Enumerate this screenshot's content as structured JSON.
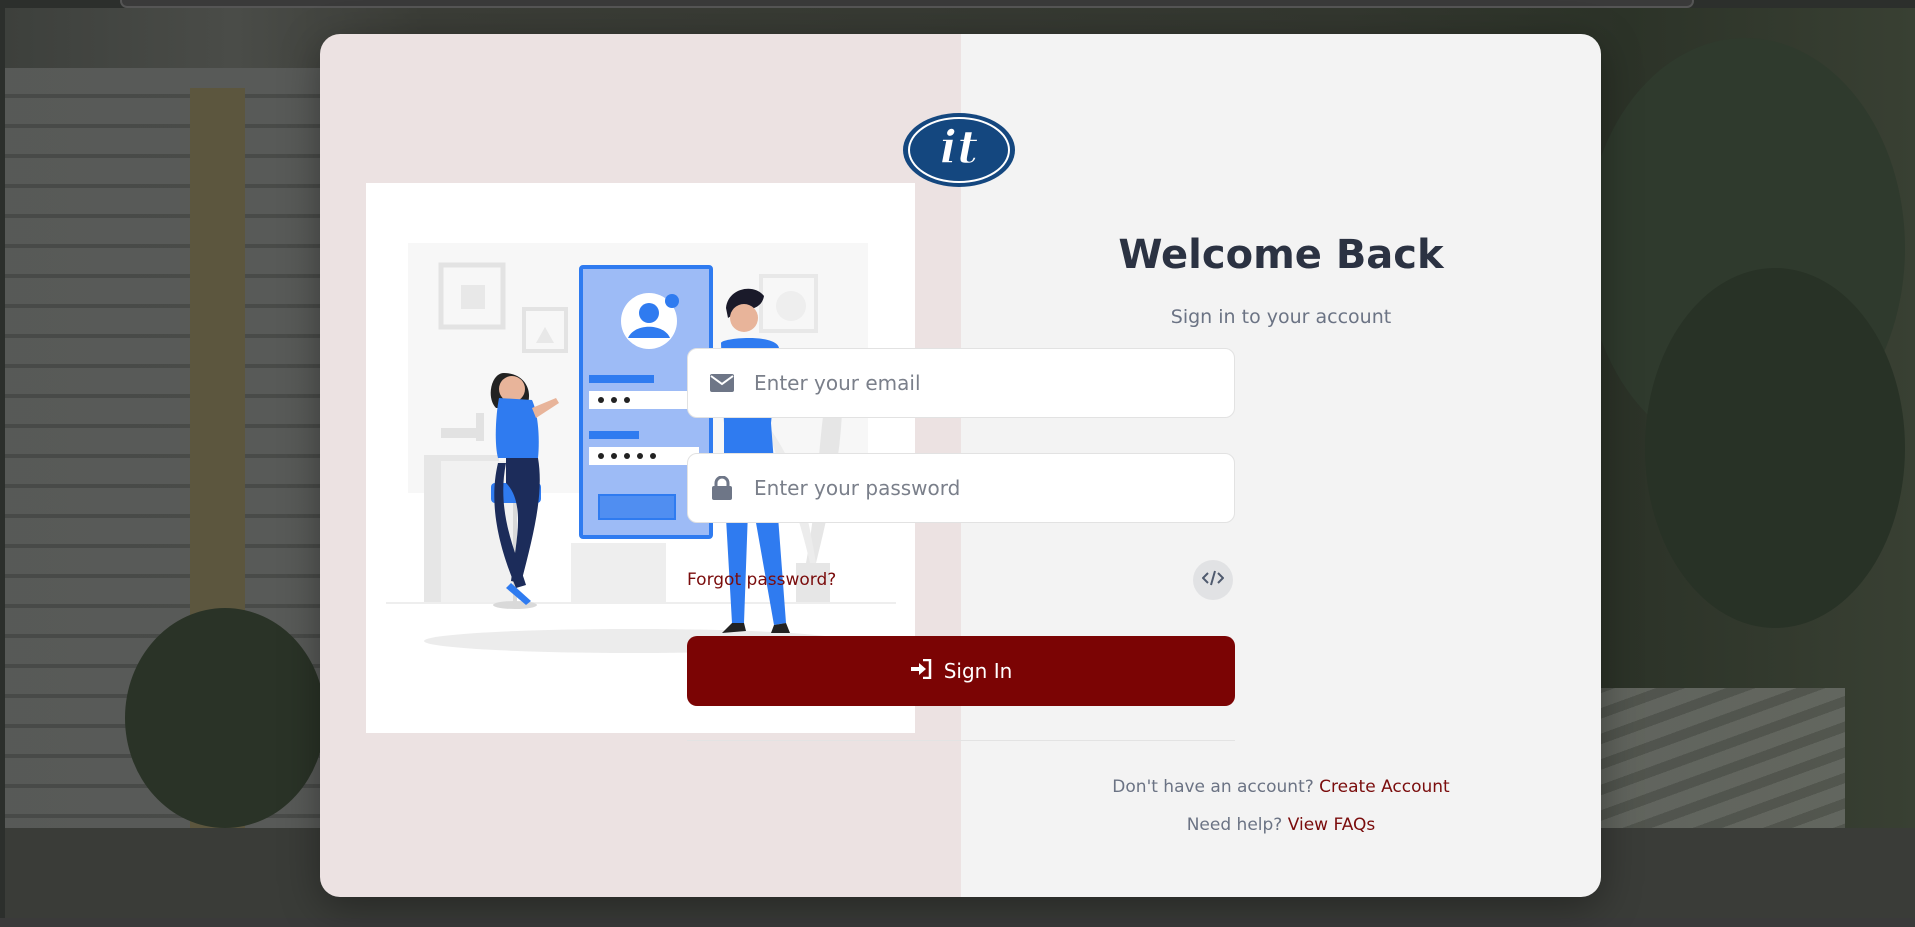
{
  "login": {
    "title": "Welcome Back",
    "subtitle": "Sign in to your account",
    "email_placeholder": "Enter your email",
    "password_placeholder": "Enter your password",
    "forgot_label": "Forgot password?",
    "signin_label": "Sign In",
    "no_account_text": "Don't have an account?",
    "create_account_label": "Create Account",
    "help_text": "Need help?",
    "faq_label": "View FAQs"
  },
  "icons": {
    "email": "envelope-icon",
    "password": "lock-icon",
    "developer": "code-icon",
    "signin": "sign-in-icon",
    "logo": "it-logo"
  },
  "colors": {
    "accent": "#7b0404",
    "link": "#7a0c0c",
    "title": "#2b3242",
    "illustration_blue": "#2f7bf0"
  }
}
